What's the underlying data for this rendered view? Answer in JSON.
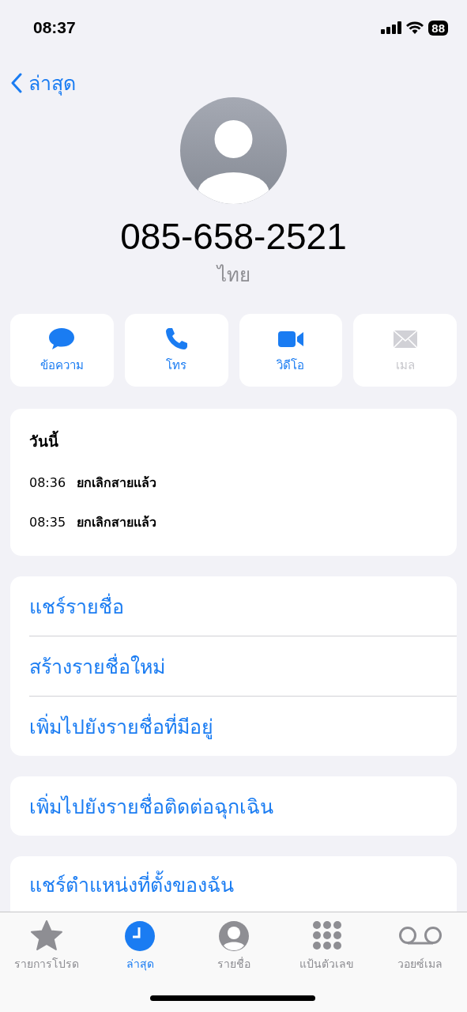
{
  "status_bar": {
    "time": "08:37",
    "battery": "88"
  },
  "nav": {
    "back": "ล่าสุด"
  },
  "contact": {
    "number": "085-658-2521",
    "country": "ไทย"
  },
  "actions": [
    {
      "label": "ข้อความ",
      "disabled": false
    },
    {
      "label": "โทร",
      "disabled": false
    },
    {
      "label": "วิดีโอ",
      "disabled": false
    },
    {
      "label": "เมล",
      "disabled": true
    }
  ],
  "calls": {
    "heading": "วันนี้",
    "rows": [
      {
        "time": "08:36",
        "status": "ยกเลิกสายแล้ว"
      },
      {
        "time": "08:35",
        "status": "ยกเลิกสายแล้ว"
      }
    ]
  },
  "groups": [
    [
      "แชร์รายชื่อ",
      "สร้างรายชื่อใหม่",
      "เพิ่มไปยังรายชื่อที่มีอยู่"
    ],
    [
      "เพิ่มไปยังรายชื่อติดต่อฉุกเฉิน"
    ],
    [
      "แชร์ตำแหน่งที่ตั้งของฉัน"
    ]
  ],
  "tabs": [
    {
      "label": "รายการโปรด",
      "selected": false
    },
    {
      "label": "ล่าสุด",
      "selected": true
    },
    {
      "label": "รายชื่อ",
      "selected": false
    },
    {
      "label": "แป้นตัวเลข",
      "selected": false
    },
    {
      "label": "วอยซ์เมล",
      "selected": false
    }
  ]
}
